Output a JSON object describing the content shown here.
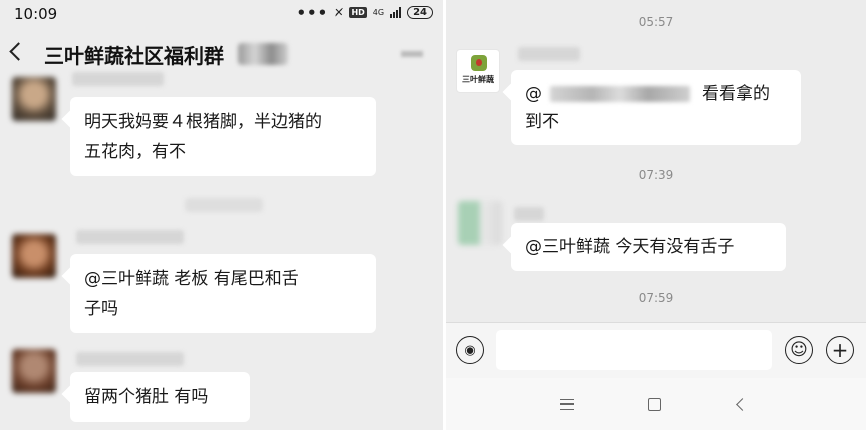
{
  "left_screen": {
    "status": {
      "time": "10:09",
      "network": "4G",
      "battery": "24"
    },
    "header": {
      "title": "三叶鲜蔬社区福利群"
    },
    "messages": [
      {
        "text_line1": "明天我妈要４根猪脚，半边猪的",
        "text_line2": "五花肉，有不"
      },
      {
        "text_line1": "@三叶鲜蔬   老板  有尾巴和舌",
        "text_line2": "子吗"
      },
      {
        "text_line1": "留两个猪肚 有吗"
      }
    ]
  },
  "right_screen": {
    "timestamps": [
      "05:57",
      "07:39",
      "07:59"
    ],
    "brand_logo_text": "三叶鲜蔬",
    "messages": [
      {
        "line1_prefix": "@",
        "line1_suffix": "看看拿的",
        "line2": "到不"
      },
      {
        "text": "@三叶鲜蔬   今天有没有舌子"
      }
    ],
    "input_bar": {
      "voice_icon": "voice-icon",
      "emoji_icon": "emoji-icon",
      "plus_icon": "plus-icon"
    },
    "nav_bar": {
      "menu_icon": "menu-icon",
      "home_icon": "home-icon",
      "back_icon": "back-icon"
    }
  },
  "colors": {
    "background": "#ededed",
    "bubble": "#ffffff",
    "text": "#191919",
    "timestamp": "#8a8a8a"
  }
}
